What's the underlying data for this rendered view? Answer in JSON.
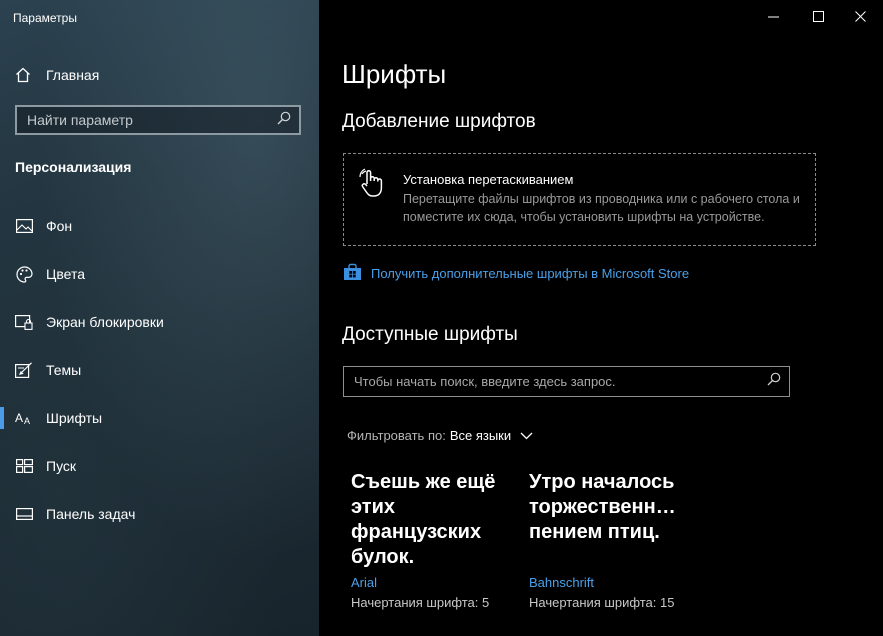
{
  "window": {
    "title": "Параметры",
    "controls": [
      "minimize",
      "maximize",
      "close"
    ]
  },
  "sidebar": {
    "home_label": "Главная",
    "search_placeholder": "Найти параметр",
    "section_title": "Персонализация",
    "items": [
      {
        "label": "Фон",
        "icon": "picture-icon"
      },
      {
        "label": "Цвета",
        "icon": "palette-icon"
      },
      {
        "label": "Экран блокировки",
        "icon": "lock-screen-icon"
      },
      {
        "label": "Темы",
        "icon": "themes-icon"
      },
      {
        "label": "Шрифты",
        "icon": "fonts-icon",
        "active": true
      },
      {
        "label": "Пуск",
        "icon": "start-icon"
      },
      {
        "label": "Панель задач",
        "icon": "taskbar-icon"
      }
    ],
    "accent": "#4b9be7"
  },
  "main": {
    "title": "Шрифты",
    "add_fonts": {
      "heading": "Добавление шрифтов",
      "dropzone_title": "Установка перетаскиванием",
      "dropzone_description": "Перетащите файлы шрифтов из проводника или с рабочего стола и поместите их сюда, чтобы установить шрифты на устройстве.",
      "store_link": "Получить дополнительные шрифты в Microsoft Store"
    },
    "available": {
      "heading": "Доступные шрифты",
      "search_placeholder": "Чтобы начать поиск, введите здесь запрос.",
      "filter_label": "Фильтровать по:",
      "filter_value": "Все языки",
      "fonts": [
        {
          "preview": "Съешь же ещё этих французских булок.",
          "name": "Arial",
          "faces": "Начертания шрифта: 5"
        },
        {
          "preview": "Утро началось торжественн… пением птиц.",
          "name": "Bahnschrift",
          "faces": "Начертания шрифта: 15"
        }
      ]
    }
  }
}
